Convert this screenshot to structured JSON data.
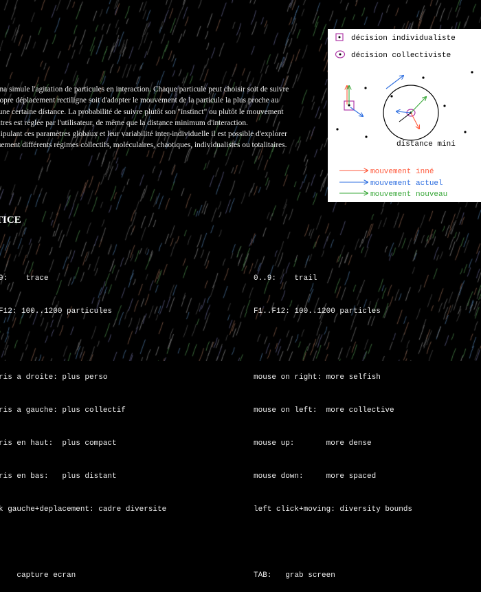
{
  "intro_lines": [
    "urna simule l'agitation de particules en interaction. Chaque particule peut choisir soit de suivre",
    "propre déplacement rectiligne soit d'adopter le mouvement de la particule la plus proche au",
    "d'une certaine distance. La probabilité de suivre plutôt son \"instinct\" ou plutôt le mouvement",
    "autres est réglée par l'utilisateur, de même que la distance minimum d'interaction.",
    "anipulant ces paramètres globaux et leur variabilité inter-individuelle il est possible d'explorer",
    "nuement différents régimes collectifs, moléculaires, chaotiques, individualistes ou totalitaires."
  ],
  "section_title": "TICE",
  "controls_fr": [
    "9:    trace",
    "F12: 100..1200 particules",
    "",
    "ris a droite: plus perso",
    "ris a gauche: plus collectif",
    "ris en haut:  plus compact",
    "ris en bas:   plus distant",
    "k gauche+deplacement: cadre diversite",
    "",
    "    capture ecran"
  ],
  "controls_en": [
    "0..9:    trail",
    "F1..F12: 100..1200 particles",
    "",
    "mouse on right: more selfish",
    "mouse on left:  more collective",
    "mouse up:       more dense",
    "mouse down:     more spaced",
    "left click+moving: diversity bounds",
    "",
    "TAB:   grab screen"
  ],
  "legend": {
    "individual": "décision individualiste",
    "collective": "décision collectiviste",
    "distance": "distance mini",
    "innate": "mouvement inné",
    "current": "mouvement actuel",
    "new": "mouvement nouveau"
  },
  "colors": {
    "background": "#000000",
    "innate": "#ff5a3c",
    "current": "#2f6fe0",
    "new": "#3aa83a",
    "marker": "#b03aa8"
  }
}
